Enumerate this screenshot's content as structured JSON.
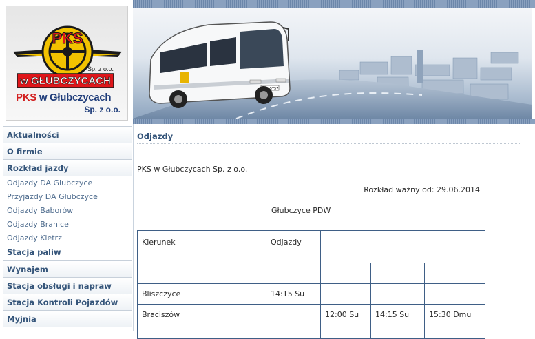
{
  "logo": {
    "emblem_text": "PKS",
    "emblem_subtitle": "Sp. z o.o.",
    "emblem_city": "w GŁUBCZYCACH",
    "name_pks": "PKS",
    "name_rest": " w Głubczycach",
    "suffix": "Sp. z o.o."
  },
  "nav": {
    "items": [
      {
        "label": "Aktualności"
      },
      {
        "label": "O firmie"
      },
      {
        "label": "Rozkład jazdy"
      }
    ],
    "sub_items": [
      {
        "label": "Odjazdy DA Głubczyce"
      },
      {
        "label": "Przyjazdy DA Głubczyce"
      },
      {
        "label": "Odjazdy Baborów"
      },
      {
        "label": "Odjazdy Branice"
      },
      {
        "label": "Odjazdy Kietrz"
      },
      {
        "label": "Stacja paliw"
      }
    ],
    "items_after": [
      {
        "label": "Wynajem"
      },
      {
        "label": "Stacja obsługi i napraw"
      },
      {
        "label": "Stacja Kontroli Pojazdów"
      },
      {
        "label": "Myjnia"
      }
    ]
  },
  "banner": {
    "bus_plate": "OGL 5T57"
  },
  "content": {
    "section_title": "Odjazdy",
    "operator": "PKS w Głubczycach Sp. z o.o.",
    "validity": "Rozkład ważny od: 29.06.2014",
    "station": "Głubczyce PDW",
    "table": {
      "header_direction": "Kierunek",
      "header_departures": "Odjazdy",
      "rows": [
        {
          "direction": "Bliszczyce",
          "times": [
            "14:15 Su",
            "",
            "",
            ""
          ]
        },
        {
          "direction": "Braciszów",
          "times": [
            "",
            "12:00 Su",
            "14:15 Su",
            "15:30 Dmu"
          ]
        }
      ]
    }
  },
  "colors": {
    "nav_text": "#35557a",
    "table_border": "#3f5f86",
    "brand_red": "#d21f1f",
    "brand_blue": "#1f3d7a"
  }
}
